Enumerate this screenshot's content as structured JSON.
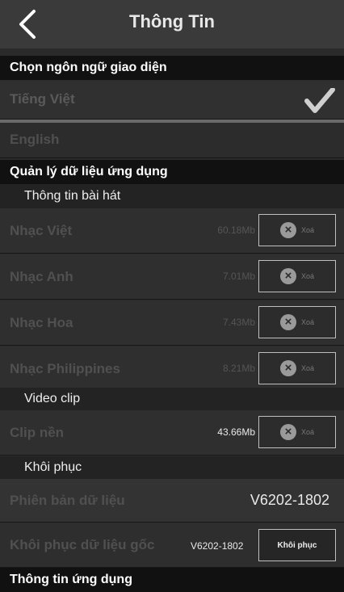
{
  "header": {
    "title": "Thông Tin"
  },
  "lang_section": {
    "label": "Chọn ngôn ngữ giao diện"
  },
  "lang_options": [
    {
      "label": "Tiếng Việt",
      "selected": true
    },
    {
      "label": "English",
      "selected": false
    }
  ],
  "data_section": {
    "label": "Quản lý dữ liệu ứng dụng"
  },
  "song_info": {
    "label": "Thông tin bài hát"
  },
  "songs": [
    {
      "label": "Nhạc Việt",
      "size": "60.18Mb",
      "delete_label": "Xoá"
    },
    {
      "label": "Nhạc Anh",
      "size": "7.01Mb",
      "delete_label": "Xoá"
    },
    {
      "label": "Nhạc Hoa",
      "size": "7.43Mb",
      "delete_label": "Xoá"
    },
    {
      "label": "Nhạc Philippines",
      "size": "8.21Mb",
      "delete_label": "Xoá"
    }
  ],
  "video_section": {
    "label": "Video clip"
  },
  "clip": {
    "label": "Clip nền",
    "size": "43.66Mb",
    "delete_label": "Xoá"
  },
  "restore_section": {
    "label": "Khôi phục"
  },
  "data_version": {
    "label": "Phiên bản dữ liệu",
    "value": "V6202-1802"
  },
  "restore": {
    "label": "Khôi phục dữ liệu gốc",
    "value": "V6202-1802",
    "button_label": "Khôi phục"
  },
  "bottom_partial": {
    "label": "Thông tin ứng dụng"
  },
  "colors": {
    "header_bg": "#3a3a3a",
    "section_bg": "#111111",
    "row_bg": "#2f2f2f"
  }
}
